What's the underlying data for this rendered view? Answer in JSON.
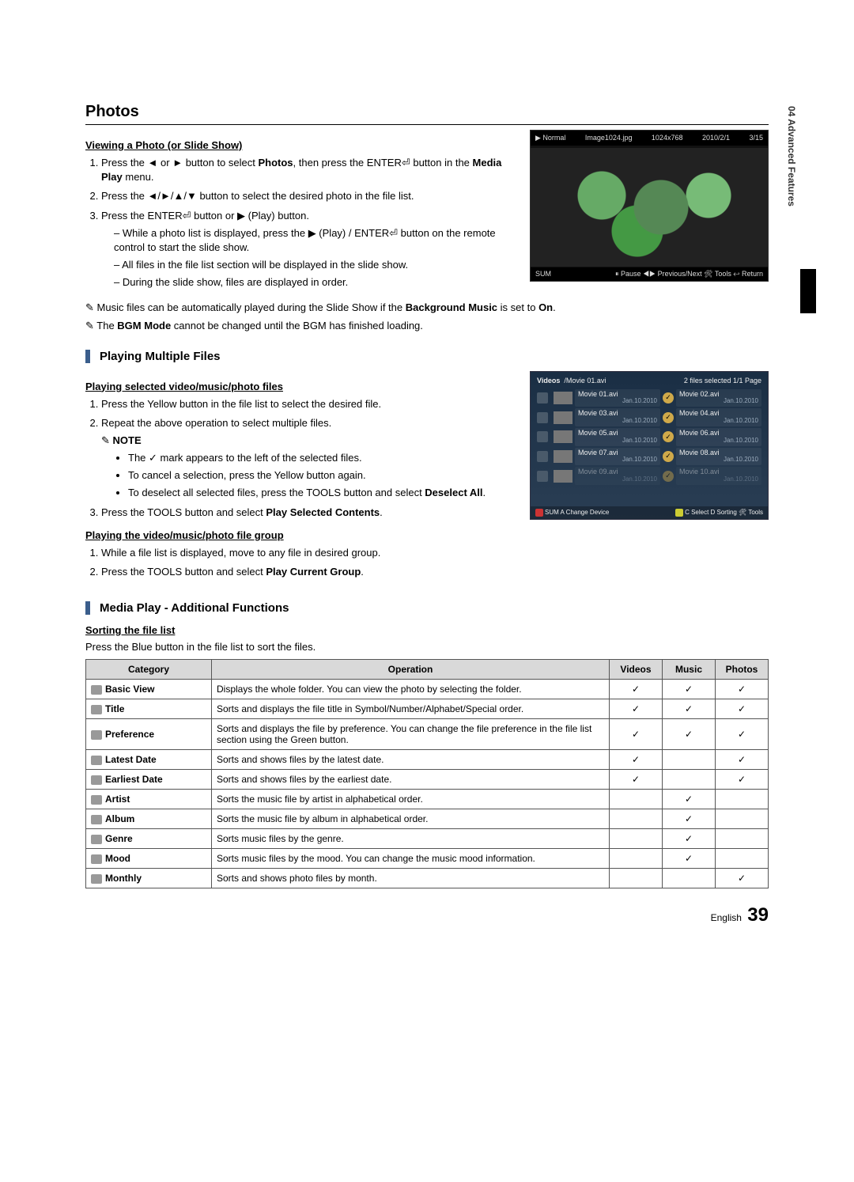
{
  "side_tab": "04  Advanced Features",
  "h1": "Photos",
  "viewing_h": "Viewing a Photo (or Slide Show)",
  "step1_a": "Press the ",
  "step1_b": " or ",
  "step1_c": " button to select ",
  "step1_photos": "Photos",
  "step1_d": ", then press the ENTER",
  "step1_e": " button in the ",
  "step1_mp": "Media Play",
  "step1_f": " menu.",
  "step2_a": "Press the ",
  "step2_b": " button to select the desired photo in the file list.",
  "step3_a": "Press the ENTER",
  "step3_b": " button or ",
  "step3_c": " (Play) button.",
  "dash1_a": "While a photo list is displayed, press the ",
  "dash1_b": " (Play) / ENTER",
  "dash1_c": " button on the remote control to start the slide show.",
  "dash2": "All files in the file list section will be displayed in the slide show.",
  "dash3": "During the slide show, files are displayed in order.",
  "tip1_a": "Music files can be automatically played during the Slide Show if the ",
  "tip1_b": "Background Music",
  "tip1_c": " is set to ",
  "tip1_d": "On",
  "tip1_e": ".",
  "tip2_a": "The ",
  "tip2_b": "BGM Mode",
  "tip2_c": " cannot be changed until the BGM has finished loading.",
  "sec_multi": "Playing Multiple Files",
  "multi_h": "Playing selected video/music/photo files",
  "m_step1": "Press the Yellow button in the file list to select the desired file.",
  "m_step2": "Repeat the above operation to select multiple files.",
  "note_label": "NOTE",
  "note_b1_a": "The ",
  "note_b1_b": " mark appears to the left of the selected files.",
  "note_b2": "To cancel a selection, press the Yellow button again.",
  "note_b3_a": "To deselect all selected files, press the TOOLS button and select ",
  "note_b3_b": "Deselect All",
  "note_b3_c": ".",
  "m_step3_a": "Press the TOOLS button and select ",
  "m_step3_b": "Play Selected Contents",
  "m_step3_c": ".",
  "group_h": "Playing the video/music/photo file group",
  "g_step1": "While a file list is displayed, move to any file in desired group.",
  "g_step2_a": "Press the TOOLS button and select ",
  "g_step2_b": "Play Current Group",
  "g_step2_c": ".",
  "sec_addl": "Media Play - Additional Functions",
  "sort_h": "Sorting the file list",
  "sort_intro": "Press the Blue button in the file list to sort the files.",
  "th_cat": "Category",
  "th_op": "Operation",
  "th_vid": "Videos",
  "th_mus": "Music",
  "th_pho": "Photos",
  "rows": [
    {
      "cat": "Basic View",
      "op": "Displays the whole folder. You can view the photo by selecting the folder.",
      "v": true,
      "m": true,
      "p": true
    },
    {
      "cat": "Title",
      "op": "Sorts and displays the file title in Symbol/Number/Alphabet/Special order.",
      "v": true,
      "m": true,
      "p": true
    },
    {
      "cat": "Preference",
      "op": "Sorts and displays the file by preference. You can change the file preference in the file list section using the Green button.",
      "v": true,
      "m": true,
      "p": true
    },
    {
      "cat": "Latest Date",
      "op": "Sorts and shows files by the latest date.",
      "v": true,
      "m": false,
      "p": true
    },
    {
      "cat": "Earliest Date",
      "op": "Sorts and shows files by the earliest date.",
      "v": true,
      "m": false,
      "p": true
    },
    {
      "cat": "Artist",
      "op": "Sorts the music file by artist in alphabetical order.",
      "v": false,
      "m": true,
      "p": false
    },
    {
      "cat": "Album",
      "op": "Sorts the music file by album in alphabetical order.",
      "v": false,
      "m": true,
      "p": false
    },
    {
      "cat": "Genre",
      "op": "Sorts music files by the genre.",
      "v": false,
      "m": true,
      "p": false
    },
    {
      "cat": "Mood",
      "op": "Sorts music files by the mood. You can change the music mood information.",
      "v": false,
      "m": true,
      "p": false
    },
    {
      "cat": "Monthly",
      "op": "Sorts and shows photo files by month.",
      "v": false,
      "m": false,
      "p": true
    }
  ],
  "ss1": {
    "mode": "▶ Normal",
    "file": "Image1024.jpg",
    "res": "1024x768",
    "date": "2010/2/1",
    "idx": "3/15",
    "sum": "SUM",
    "foot": "⏸ Pause  ◀▶ Previous/Next  🛠 Tools  ↩ Return"
  },
  "ss2": {
    "cat": "Videos",
    "path": "/Movie 01.avi",
    "sel": "2 files selected   1/1 Page",
    "items": [
      {
        "l": "Movie 01.avi",
        "d": "Jan.10.2010",
        "chk": true,
        "r": "Movie 02.avi",
        "rd": "Jan.10.2010"
      },
      {
        "l": "Movie 03.avi",
        "d": "Jan.10.2010",
        "chk": true,
        "r": "Movie 04.avi",
        "rd": "Jan.10.2010"
      },
      {
        "l": "Movie 05.avi",
        "d": "Jan.10.2010",
        "chk": true,
        "r": "Movie 06.avi",
        "rd": "Jan.10.2010"
      },
      {
        "l": "Movie 07.avi",
        "d": "Jan.10.2010",
        "chk": true,
        "r": "Movie 08.avi",
        "rd": "Jan.10.2010"
      },
      {
        "l": "Movie 09.avi",
        "d": "Jan.10.2010",
        "chk": true,
        "r": "Movie 10.avi",
        "rd": "Jan.10.2010",
        "dim": true
      }
    ],
    "foot_l": "SUM  A Change Device",
    "foot_r": "C Select   D Sorting   🛠 Tools"
  },
  "foot_lang": "English",
  "foot_pg": "39",
  "glyph": {
    "l": "◄",
    "r": "►",
    "u": "▲",
    "d": "▼",
    "enter": "⏎",
    "play": "▶",
    "check": "✓",
    "arrows": "◄/►/▲/▼"
  }
}
